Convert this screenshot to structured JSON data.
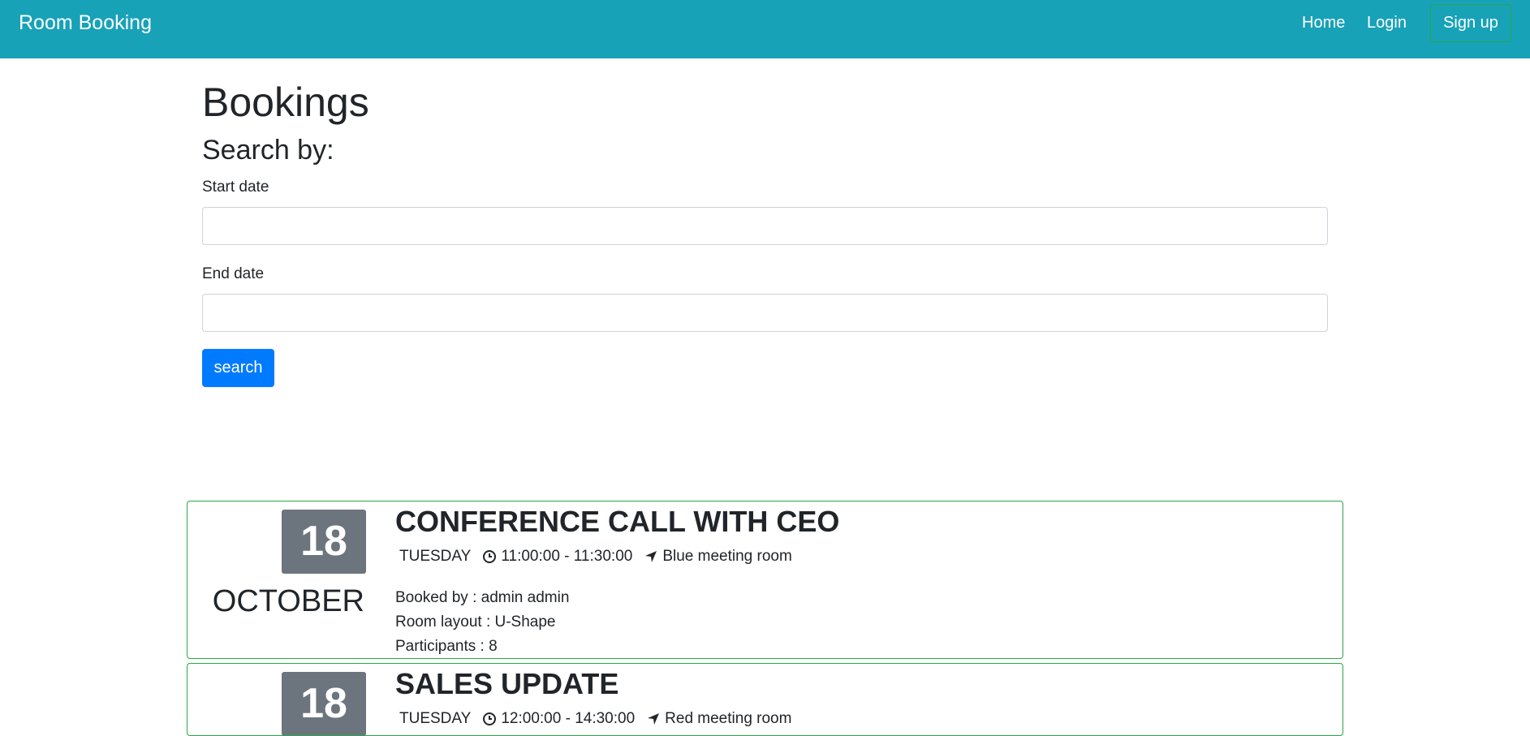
{
  "navbar": {
    "brand": "Room Booking",
    "links": {
      "home": "Home",
      "login": "Login",
      "signup": "Sign up"
    }
  },
  "page": {
    "title": "Bookings",
    "search_heading": "Search by:",
    "start_label": "Start date",
    "start_value": "",
    "end_label": "End date",
    "end_value": "",
    "search_button": "search"
  },
  "bookings": [
    {
      "day": "18",
      "month": "OCTOBER",
      "title": "CONFERENCE CALL WITH CEO",
      "weekday": "TUESDAY",
      "time": "11:00:00 - 11:30:00",
      "room": "Blue meeting room",
      "booked_by": "Booked by : admin admin",
      "layout": "Room layout : U-Shape",
      "participants": "Participants : 8"
    },
    {
      "day": "18",
      "title": "SALES UPDATE",
      "weekday": "TUESDAY",
      "time": "12:00:00 - 14:30:00",
      "room": "Red meeting room"
    }
  ],
  "colors": {
    "navbar": "#17a2b8",
    "primary": "#007bff",
    "card_border": "#28a745",
    "date_box": "#6c757d"
  }
}
